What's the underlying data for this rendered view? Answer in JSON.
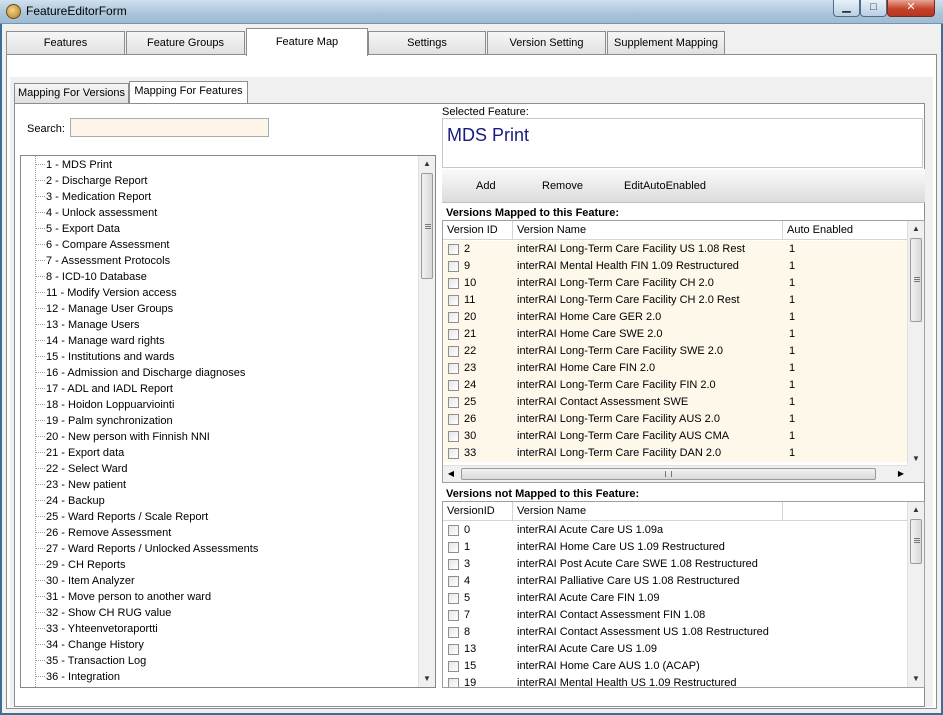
{
  "window": {
    "title": "FeatureEditorForm",
    "min_glyph": "▁",
    "max_glyph": "□",
    "close_glyph": "✕"
  },
  "tabs": [
    "Features",
    "Feature Groups",
    "Feature Map",
    "Settings",
    "Version Setting",
    "Supplement Mapping"
  ],
  "active_tab": "Feature Map",
  "subtabs": [
    "Mapping For Versions",
    "Mapping For Features"
  ],
  "active_subtab": "Mapping For Features",
  "search": {
    "label": "Search:",
    "value": ""
  },
  "features": [
    "1 - MDS Print",
    "2 - Discharge Report",
    "3 - Medication Report",
    "4 - Unlock assessment",
    "5 - Export Data",
    "6 - Compare Assessment",
    "7 - Assessment Protocols",
    "8 - ICD-10 Database",
    "11 - Modify Version access",
    "12 - Manage User Groups",
    "13 - Manage Users",
    "14 - Manage ward rights",
    "15 - Institutions and wards",
    "16 - Admission and Discharge diagnoses",
    "17 - ADL and IADL Report",
    "18 - Hoidon Loppuarviointi",
    "19 - Palm synchronization",
    "20 - New person with Finnish NNI",
    "21 - Export data",
    "22 - Select Ward",
    "23 - New patient",
    "24 - Backup",
    "25 - Ward Reports / Scale Report",
    "26 - Remove Assessment",
    "27 - Ward Reports / Unlocked Assessments",
    "29 - CH Reports",
    "30 - Item Analyzer",
    "31 - Move person to another ward",
    "32 - Show CH RUG value",
    "33 - Yhteenvetoraportti",
    "34 - Change History",
    "35 - Transaction Log",
    "36 - Integration"
  ],
  "selected_feature": {
    "label": "Selected Feature:",
    "value": "MDS Print"
  },
  "toolbar": {
    "add": "Add",
    "remove": "Remove",
    "edit_auto_enabled": "EditAutoEnabled"
  },
  "mapped": {
    "title": "Versions Mapped to this Feature:",
    "columns": [
      "Version ID",
      "Version Name",
      "Auto Enabled"
    ],
    "rows": [
      [
        "2",
        "interRAI Long-Term Care Facility US 1.08 Rest",
        "1"
      ],
      [
        "9",
        "interRAI Mental Health FIN 1.09 Restructured",
        "1"
      ],
      [
        "10",
        "interRAI Long-Term Care Facility CH 2.0",
        "1"
      ],
      [
        "11",
        "interRAI Long-Term Care Facility CH 2.0 Rest",
        "1"
      ],
      [
        "20",
        "interRAI Home Care GER 2.0",
        "1"
      ],
      [
        "21",
        "interRAI Home Care SWE 2.0",
        "1"
      ],
      [
        "22",
        "interRAI Long-Term Care Facility SWE 2.0",
        "1"
      ],
      [
        "23",
        "interRAI Home Care FIN 2.0",
        "1"
      ],
      [
        "24",
        "interRAI Long-Term Care Facility FIN 2.0",
        "1"
      ],
      [
        "25",
        "interRAI Contact Assessment SWE",
        "1"
      ],
      [
        "26",
        "interRAI Long-Term Care Facility AUS 2.0",
        "1"
      ],
      [
        "30",
        "interRAI Long-Term Care Facility AUS CMA",
        "1"
      ],
      [
        "33",
        "interRAI Long-Term Care Facility DAN 2.0",
        "1"
      ]
    ]
  },
  "not_mapped": {
    "title": "Versions not Mapped to this Feature:",
    "columns": [
      "VersionID",
      "Version Name"
    ],
    "rows": [
      [
        "0",
        "interRAI Acute Care US 1.09a"
      ],
      [
        "1",
        "interRAI Home Care US 1.09 Restructured"
      ],
      [
        "3",
        "interRAI Post Acute Care SWE 1.08 Restructured"
      ],
      [
        "4",
        "interRAI Palliative Care US 1.08 Restructured"
      ],
      [
        "5",
        "interRAI Acute Care FIN 1.09"
      ],
      [
        "7",
        "interRAI Contact Assessment FIN 1.08"
      ],
      [
        "8",
        "interRAI Contact Assessment US 1.08 Restructured"
      ],
      [
        "13",
        "interRAI Acute Care US 1.09"
      ],
      [
        "15",
        "interRAI Home Care AUS 1.0 (ACAP)"
      ],
      [
        "19",
        "interRAI Mental Health US 1.09 Restructured"
      ]
    ]
  }
}
